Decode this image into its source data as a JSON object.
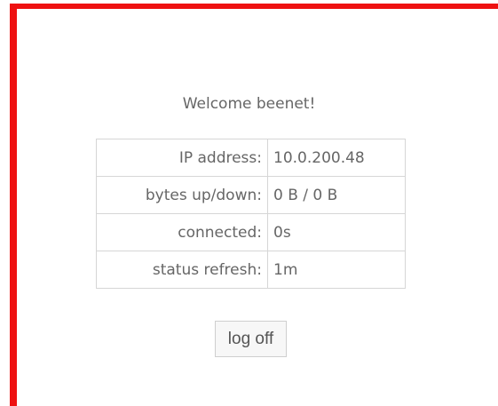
{
  "welcome": {
    "text": "Welcome beenet!"
  },
  "status": {
    "rows": [
      {
        "label": "IP address:",
        "value": "10.0.200.48"
      },
      {
        "label": "bytes up/down:",
        "value": "0 B / 0 B"
      },
      {
        "label": "connected:",
        "value": "0s"
      },
      {
        "label": "status refresh:",
        "value": "1m"
      }
    ]
  },
  "actions": {
    "logoff_label": "log off"
  },
  "colors": {
    "frame_border": "#ee1111",
    "text": "#666666",
    "cell_border": "#d6d6d6"
  }
}
